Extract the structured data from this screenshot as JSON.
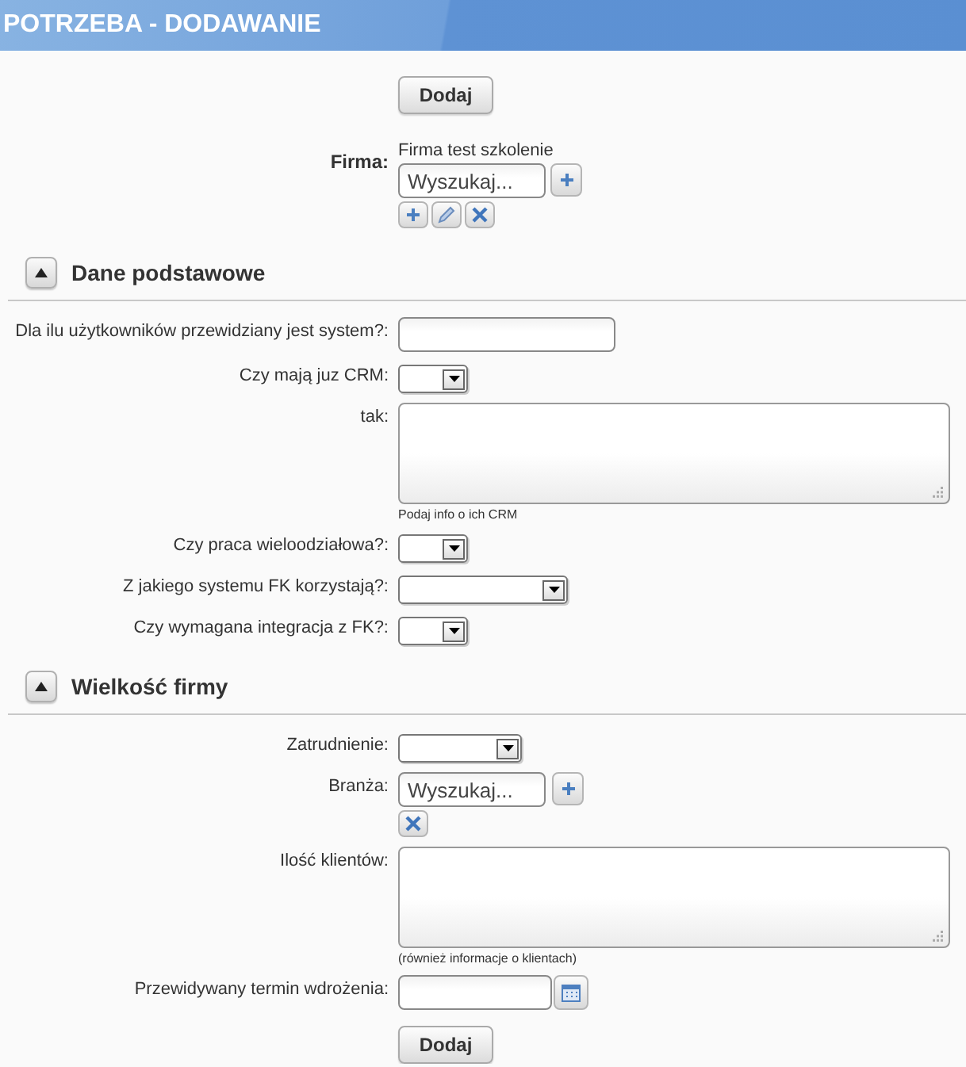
{
  "header": {
    "title": "POTRZEBA - DODAWANIE"
  },
  "top_button": {
    "label": "Dodaj"
  },
  "company": {
    "label": "Firma:",
    "value": "Firma test szkolenie",
    "search": {
      "placeholder": "Wyszukaj..."
    },
    "actions": [
      {
        "kind": "add"
      },
      {
        "kind": "edit"
      },
      {
        "kind": "remove"
      }
    ]
  },
  "sections": [
    {
      "title": "Dane podstawowe",
      "expanded": true,
      "fields": [
        {
          "kind": "text",
          "label": "Dla ilu użytkowników przewidziany jest system?:"
        },
        {
          "kind": "select",
          "label": "Czy mają juz CRM:"
        },
        {
          "kind": "textarea",
          "label": "tak:",
          "hint": "Podaj info o ich CRM"
        },
        {
          "kind": "select",
          "label": "Czy praca wieloodziałowa?:"
        },
        {
          "kind": "select",
          "label": "Z jakiego systemu FK korzystają?:"
        },
        {
          "kind": "select",
          "label": "Czy wymagana integracja z FK?:"
        }
      ]
    },
    {
      "title": "Wielkość firmy",
      "expanded": true,
      "fields": [
        {
          "kind": "select",
          "label": "Zatrudnienie:"
        },
        {
          "kind": "search",
          "label": "Branża:",
          "placeholder": "Wyszukaj...",
          "actions": [
            {
              "kind": "remove"
            }
          ]
        },
        {
          "kind": "textarea",
          "label": "Ilość klientów:",
          "hint": "(również informacje o klientach)"
        },
        {
          "kind": "date",
          "label": "Przewidywany termin wdrożenia:"
        }
      ]
    }
  ],
  "bottom_button": {
    "label": "Dodaj"
  }
}
